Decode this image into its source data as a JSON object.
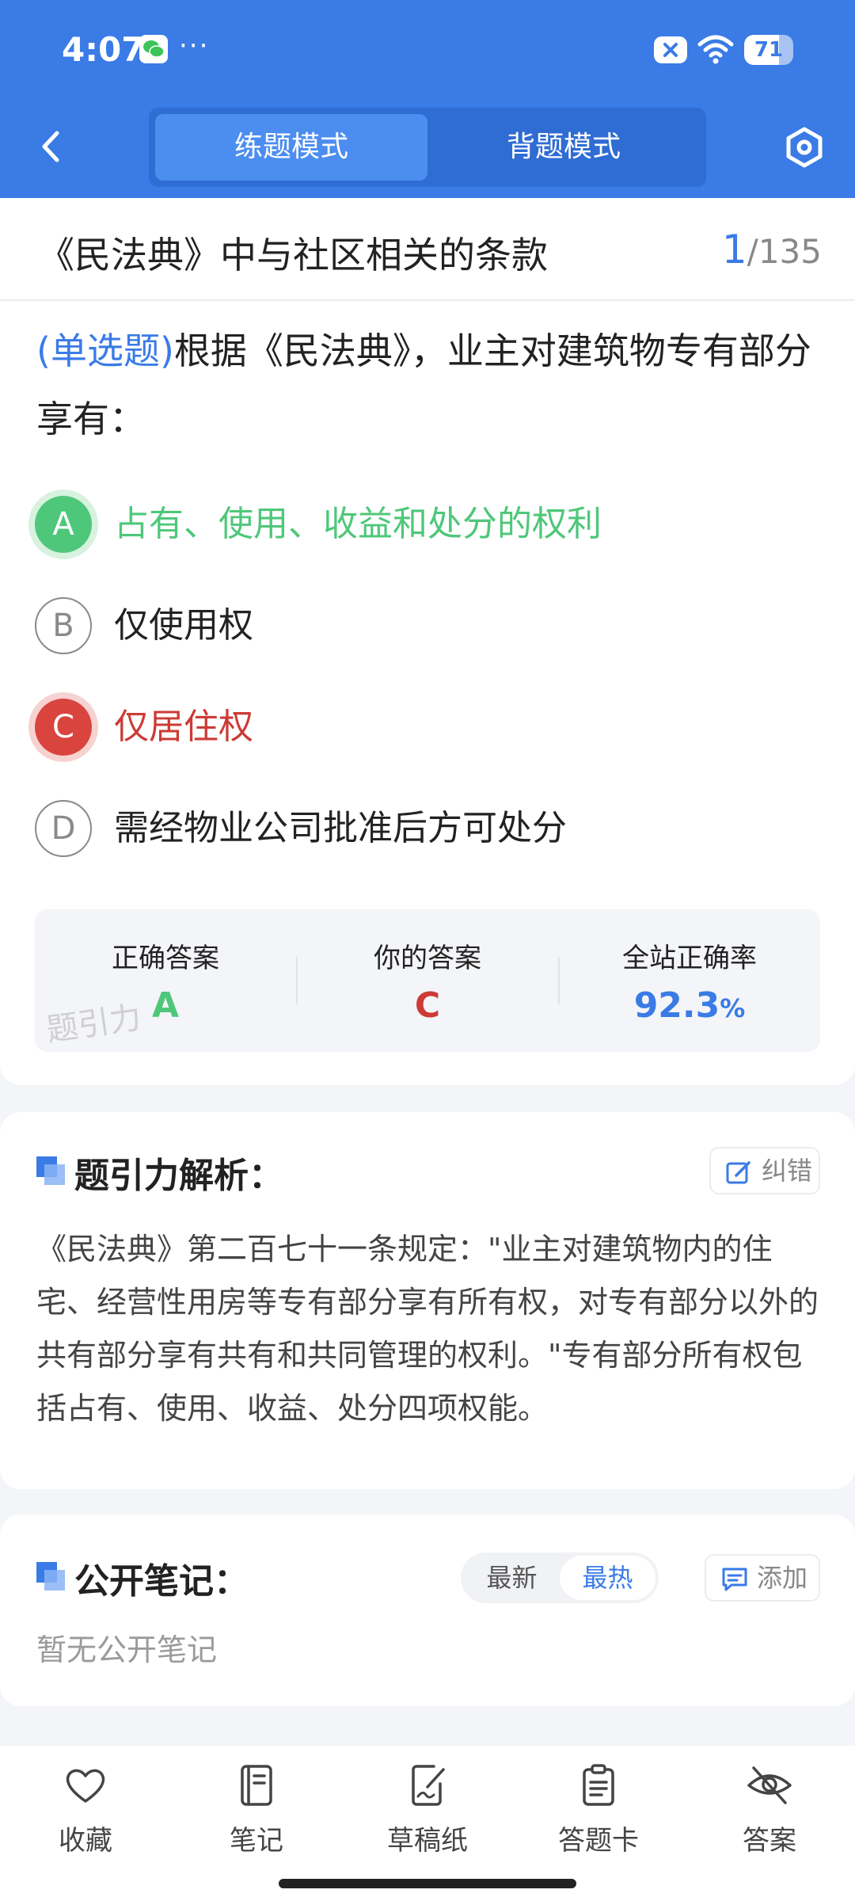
{
  "status_bar": {
    "time": "4:07",
    "dots": "···",
    "battery": "71",
    "battery_level": 0.71
  },
  "header": {
    "tab_practice": "练题模式",
    "tab_review": "背题模式"
  },
  "question": {
    "chapter": "《民法典》中与社区相关的条款",
    "current": "1",
    "total": "/135",
    "type": "(单选题)",
    "text": "根据《民法典》，业主对建筑物专有部分享有："
  },
  "options": [
    {
      "letter": "A",
      "text": "占有、使用、收益和处分的权利",
      "state": "correct"
    },
    {
      "letter": "B",
      "text": "仅使用权",
      "state": "normal"
    },
    {
      "letter": "C",
      "text": "仅居住权",
      "state": "wrong"
    },
    {
      "letter": "D",
      "text": "需经物业公司批准后方可处分",
      "state": "normal"
    }
  ],
  "answer_summary": {
    "correct_label": "正确答案",
    "correct_value": "A",
    "your_label": "你的答案",
    "your_value": "C",
    "rate_label": "全站正确率",
    "rate_value": "92.3",
    "rate_unit": "%",
    "watermark": "题引力"
  },
  "analysis": {
    "title": "题引力解析：",
    "report_label": "纠错",
    "text": "《民法典》第二百七十一条规定：\"业主对建筑物内的住宅、经营性用房等专有部分享有所有权，对专有部分以外的共有部分享有共有和共同管理的权利。\"专有部分所有权包括占有、使用、收益、处分四项权能。"
  },
  "notes": {
    "title": "公开笔记：",
    "sort_latest": "最新",
    "sort_hot": "最热",
    "add_label": "添加",
    "empty": "暂无公开笔记"
  },
  "bottom_nav": [
    {
      "label": "收藏",
      "icon": "heart-icon"
    },
    {
      "label": "笔记",
      "icon": "notebook-icon"
    },
    {
      "label": "草稿纸",
      "icon": "draft-icon"
    },
    {
      "label": "答题卡",
      "icon": "clipboard-icon"
    },
    {
      "label": "答案",
      "icon": "eye-off-icon"
    }
  ],
  "colors": {
    "primary": "#3a7be6",
    "correct": "#4fc77a",
    "wrong": "#d9443f"
  }
}
